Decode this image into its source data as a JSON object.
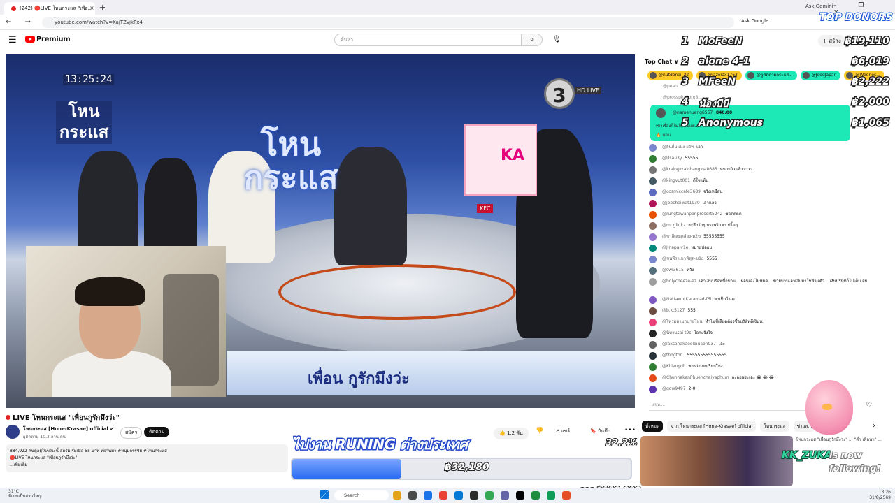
{
  "browser": {
    "tab_title": "(242) 🔴LIVE โหนกระแส \"เพื่อ...",
    "tab_close": "×",
    "new_tab": "+",
    "ask_gemini": "Ask Gemini",
    "window_controls": "– ❐ ×",
    "nav": "← → ⟳",
    "url": "youtube.com/watch?v=KajTZvjkPx4",
    "ask_google": "Ask Google"
  },
  "youtube_header": {
    "brand": "Premium",
    "search_placeholder": "ค้นหา",
    "search_icon": "search-icon",
    "mic_icon": "mic-icon",
    "create_label": "+ สร้าง"
  },
  "video": {
    "timestamp": "13:25:24",
    "channel_number": "3",
    "hd_live": "HD LIVE",
    "show_logo": "โหน กระแส",
    "show_logo_big": "โหน กระแส",
    "ad_text": "KA",
    "kfc": "KFC",
    "lower_third": "เพื่อน กูรักมึงว่ะ"
  },
  "under_video": {
    "title": "LIVE โหนกระแส \"เพื่อนกูรักมึงว่ะ\"",
    "channel_name": "โหนกระแส [Hone-Krasae] official ✔",
    "subscribers": "ผู้ติดตาม 10.3 ล้าน คน",
    "join_label": "สมัคร",
    "subscribe_label": "ติดตาม",
    "likes": "👍 1.2 พัน",
    "dislike": "👎",
    "share_label": "↗ แชร์",
    "save_label": "🔖 บันทึก",
    "more": "•••",
    "desc_line1": "884,922 คนดูอยู่ในขณะนี้ สตรีมเริ่มเมื่อ 55 นาที ที่ผ่านมา #หนุ่มกรรชัย #โหนกระแส",
    "desc_line2": "🔴LIVE โหนกระแส \"เพื่อนกูรักมึงว่ะ\"",
    "desc_more": "...เพิ่มเติม"
  },
  "weather": {
    "temp": "31°C",
    "condition": "มีเมฆเป็นส่วนใหญ่"
  },
  "chat": {
    "header": "Top Chat ∨",
    "pinned": [
      {
        "name": "@nutdonai_22",
        "color": "#ffca28"
      },
      {
        "name": "@lazerzx1763",
        "color": "#ffca28"
      },
      {
        "name": "@ผู้ติดตามกระแส...",
        "color": "#1de9b6"
      },
      {
        "name": "@JeedJapan",
        "color": "#1de9b6"
      },
      {
        "name": "@Wednes...",
        "color": "#ffca28"
      }
    ],
    "faded_rows": [
      "@peau...",
      "@prossphakorn8..."
    ],
    "super_chat": {
      "name": "@namenueng6567",
      "amount": "840.00",
      "message": "เข้าเรื่องก็ไม่ได้เงินแต่...",
      "footer": "🔥 ฟอน"
    },
    "messages": [
      {
        "name": "@ยืนดื่มแป้ง-ยวิท",
        "msg": "เอ้า",
        "color": "#7986cb"
      },
      {
        "name": "@Usa-i3y",
        "msg": "55555",
        "color": "#2e7d32"
      },
      {
        "name": "@kreingkraichangloa8685",
        "msg": "หนายวิวแล้ววววว",
        "color": "#757575"
      },
      {
        "name": "@kingvut001",
        "msg": "ดีใจแท้น",
        "color": "#455a64"
      },
      {
        "name": "@cosmiccafe3689",
        "msg": "จริงเหมือน",
        "color": "#5c6bc0"
      },
      {
        "name": "@jobchaiwat1939",
        "msg": "เอาแล้ว",
        "color": "#ad1457"
      },
      {
        "name": "@rungtawanpanpresert5242",
        "msg": "ชอตตตต",
        "color": "#e65100"
      },
      {
        "name": "@mr.glinkz",
        "msg": "สะลึกรักๆ กระพริบตา ปริ้นๆ",
        "color": "#8d6e63"
      },
      {
        "name": "@ชาลีเสมคล้อง-ท2ข",
        "msg": "55555555",
        "color": "#9575cd"
      },
      {
        "name": "@Jinapa-v1e",
        "msg": "หมายปลอม",
        "color": "#00897b"
      },
      {
        "name": "@ชนพีราเบาฟ์สุด-ช8ธ",
        "msg": "5555",
        "color": "#7986cb"
      },
      {
        "name": "@swi3615",
        "msg": "หวัง",
        "color": "#546e7a"
      },
      {
        "name": "@holycheeze-ez",
        "msg": "เอาเงินบริษัทชื้อบ้าน .. ผ่อนเองไม่หมด .. ขายบ้านเอาเงินมาใช้ส่วนตัว .. เงินบริษัทก็ไม่เต็ม จบ",
        "color": "#9e9e9e",
        "tall": true
      },
      {
        "name": "@NattawutKaramad-f6i",
        "msg": "ตาเป็นไรวะ",
        "color": "#7e57c2"
      },
      {
        "name": "@b.k.5127",
        "msg": "555",
        "color": "#6d4c41"
      },
      {
        "name": "@โทรมมามกนายโหน",
        "msg": "ทำไมขี้เลียดต้องซื้อบริษัทดีเงินบ.",
        "color": "#ec407a"
      },
      {
        "name": "@นิทานsai-t9s",
        "msg": "ไอกะจังใจ",
        "color": "#212121"
      },
      {
        "name": "@laksanakaeoloiuaon937",
        "msg": "เละ",
        "color": "#616161"
      },
      {
        "name": "@thogton.",
        "msg": "555555555555555",
        "color": "#263238"
      },
      {
        "name": "@Killerqkill",
        "msg": "พอรว่าเคยเรียกโกง",
        "color": "#2e7d32"
      },
      {
        "name": "@ChunhakanPhuenchaiyaphum",
        "msg": "ละออพระเละ 😂 😂 😂",
        "color": "#e64a19"
      },
      {
        "name": "@gow9497",
        "msg": "2-0",
        "color": "#5e35b1"
      }
    ],
    "input_placeholder": "แชท...",
    "tabs": [
      "ทั้งหมด",
      "จาก โหนกระแส [Hone-Krasae] official",
      "โหนกระแส",
      "ข่าวส..."
    ],
    "tabs_next": "›",
    "rec_text": "โหนกระแส \"เพื่อนกูรักมึงว่ะ\" ... \"ต่ำ เพื่อนฯ\" ..."
  },
  "overlays": {
    "top_donors_title": "TOP DONORS",
    "donors": [
      {
        "rank": "1",
        "name": "MoFeeN",
        "amount": "฿19,110"
      },
      {
        "rank": "2",
        "name": "alone 4-1",
        "amount": "฿6,019"
      },
      {
        "rank": "3",
        "name": "MFeeN",
        "amount": "฿2,222"
      },
      {
        "rank": "4",
        "name": "น้องบีบี",
        "amount": "฿2,000"
      },
      {
        "rank": "5",
        "name": "Anonymous",
        "amount": "฿1,065"
      }
    ],
    "goal_title": "ไปงาน RUNING ต่างประเทศ",
    "goal_percent_text": "32.2%",
    "goal_percent": 0.322,
    "goal_current": "฿32,180",
    "goal_target": "จาก ฿100,000",
    "follow_name": "KK_ZUKA",
    "follow_text1": "is now",
    "follow_text2": "following!"
  },
  "taskbar": {
    "search": "Search",
    "time": "13:26",
    "date": "31/8/2569"
  },
  "colors": {
    "super_chat": "#1de9b6",
    "youtube_red": "#ff0000",
    "goal_fill": "#2b6cf0",
    "donor_stroke": "#1d1d1d"
  }
}
